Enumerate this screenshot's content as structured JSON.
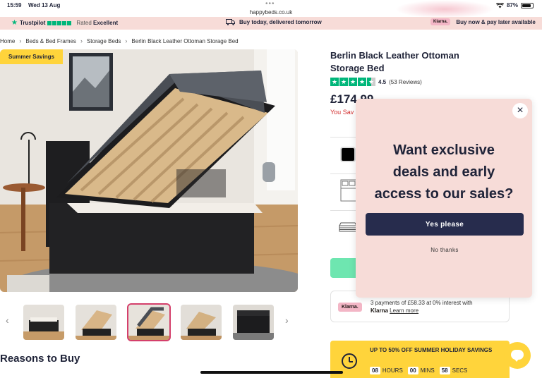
{
  "status_bar": {
    "time": "15:59",
    "date": "Wed 13 Aug",
    "url": "happybeds.co.uk",
    "battery": "87%",
    "battery_level": 0.87
  },
  "promo_bar": {
    "trustpilot": "Trustpilot",
    "rated_prefix": "Rated",
    "rated_value": "Excellent",
    "delivery": "Buy today, delivered tomorrow",
    "klarna_logo": "Klarna.",
    "klarna_text": "Buy now & pay later available"
  },
  "breadcrumb": {
    "items": [
      "Home",
      "Beds & Bed Frames",
      "Storage Beds",
      "Berlin Black Leather Ottoman Storage Bed"
    ]
  },
  "gallery": {
    "badge": "Summer Savings",
    "active_thumb": 3,
    "thumb_count": 5
  },
  "product": {
    "title_line1": "Berlin Black Leather Ottoman",
    "title_line2": "Storage Bed",
    "rating_value": "4.5",
    "rating_count": "(53 Reviews)",
    "price": "£174.99",
    "saving_text": "You Sav",
    "klarna_logo": "Klarna.",
    "klarna_line1": "3 payments of £58.33 at 0% interest with",
    "klarna_brand": "Klarna",
    "klarna_link": "Learn more",
    "sale_title": "UP TO 50% OFF SUMMER HOLIDAY SAVINGS",
    "timer": {
      "hours": "08",
      "hours_label": "HOURS",
      "mins": "00",
      "mins_label": "MINS",
      "secs": "58",
      "secs_label": "SECS"
    }
  },
  "section": {
    "reasons": "Reasons to Buy"
  },
  "popup": {
    "line1": "Want exclusive",
    "line2": "deals and early",
    "line3": "access to our sales?",
    "yes": "Yes please",
    "no": "No thanks",
    "close": "×"
  },
  "colors": {
    "navy": "#1f2338",
    "button_navy": "#272c4d",
    "popup_bg": "#f7dcd8",
    "trustpilot_green": "#00b67a",
    "yellow": "#ffd43b",
    "saving_red": "#d32f2f"
  }
}
